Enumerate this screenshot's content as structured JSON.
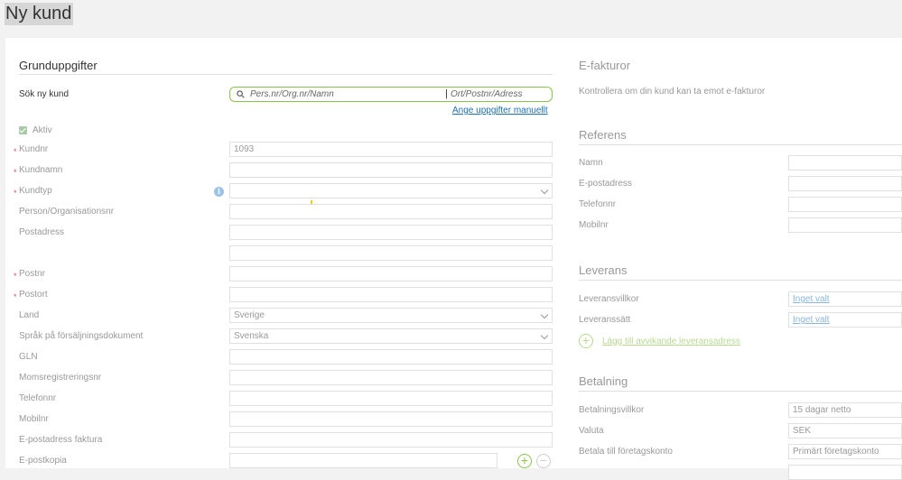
{
  "page_title": "Ny kund",
  "left": {
    "section_title": "Grunduppgifter",
    "search": {
      "label": "Sök ny kund",
      "placeholder_left": "Pers.nr/Org.nr/Namn",
      "placeholder_right": "Ort/Postnr/Adress",
      "manual_link": "Ange uppgifter manuellt"
    },
    "active_label": "Aktiv",
    "fields": {
      "kundnr": {
        "label": "Kundnr",
        "value": "1093"
      },
      "kundnamn": {
        "label": "Kundnamn",
        "value": ""
      },
      "kundtyp": {
        "label": "Kundtyp",
        "value": ""
      },
      "orgnr": {
        "label": "Person/Organisationsnr",
        "value": ""
      },
      "postadress": {
        "label": "Postadress",
        "value": ""
      },
      "postnr": {
        "label": "Postnr",
        "value": ""
      },
      "postort": {
        "label": "Postort",
        "value": ""
      },
      "land": {
        "label": "Land",
        "value": "Sverige"
      },
      "sprak": {
        "label": "Språk på försäljningsdokument",
        "value": "Svenska"
      },
      "gln": {
        "label": "GLN",
        "value": ""
      },
      "moms": {
        "label": "Momsregistreringsnr",
        "value": ""
      },
      "telefon": {
        "label": "Telefonnr",
        "value": ""
      },
      "mobil": {
        "label": "Mobilnr",
        "value": ""
      },
      "epost_faktura": {
        "label": "E-postadress faktura",
        "value": ""
      },
      "epost_kopia": {
        "label": "E-postkopia",
        "value": ""
      }
    },
    "required_mark": "*",
    "info_glyph": "i",
    "add_glyph": "+",
    "remove_glyph": "−"
  },
  "right": {
    "efaktura": {
      "title": "E-fakturor",
      "text": "Kontrollera om din kund kan ta emot e-fakturor"
    },
    "referens": {
      "title": "Referens",
      "namn": "Namn",
      "epost": "E-postadress",
      "telefon": "Telefonnr",
      "mobil": "Mobilnr"
    },
    "leverans": {
      "title": "Leverans",
      "villkor_label": "Leveransvillkor",
      "villkor_value": "Inget valt",
      "satt_label": "Leveranssätt",
      "satt_value": "Inget valt",
      "add_address": "Lägg till avvikande leveransadress"
    },
    "betalning": {
      "title": "Betalning",
      "villkor_label": "Betalningsvillkor",
      "villkor_value": "15 dagar netto",
      "valuta_label": "Valuta",
      "valuta_value": "SEK",
      "konto_label": "Betala till företagskonto",
      "konto_value": "Primärt företagskonto"
    }
  },
  "colors": {
    "accent_green": "#8bc34a",
    "link_blue": "#1a6fb5",
    "required_red": "#d9534f"
  }
}
